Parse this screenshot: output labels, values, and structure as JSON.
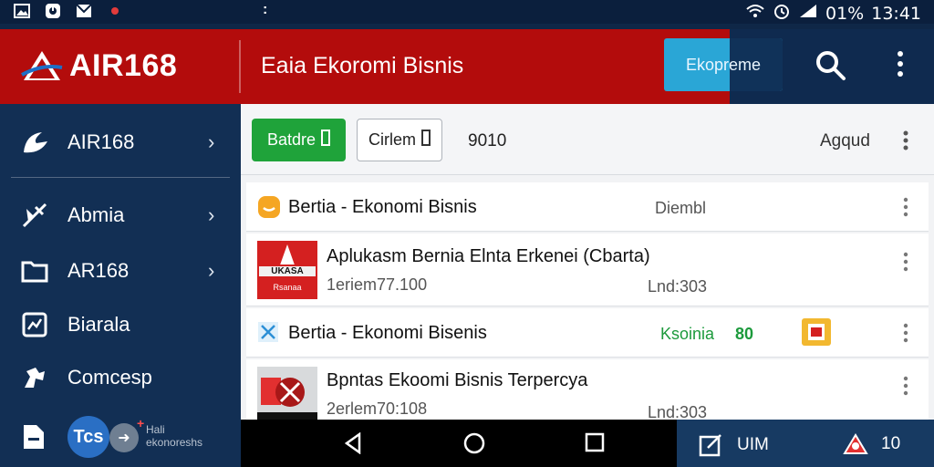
{
  "status_bar": {
    "left_icons": [
      "image-icon",
      "signal-app-icon",
      "mail-icon",
      "notification-dot-icon"
    ],
    "center": ":",
    "battery": "01%",
    "time": "13:41"
  },
  "header": {
    "app_name": "AIR168",
    "title": "Eaia Ekoromi Bisnis",
    "action_button": "Ekopreme",
    "colors": {
      "header_red": "#b30c0c",
      "header_navy": "#0f2a4f",
      "action_blue": "#2aa6d6"
    }
  },
  "sidebar": {
    "items": [
      {
        "label": "AIR168",
        "icon": "airline-logo-icon",
        "chevron": "›"
      },
      {
        "label": "Abmia",
        "icon": "satellite-icon",
        "chevron": "›"
      },
      {
        "label": "AR168",
        "icon": "folder-icon",
        "chevron": "›"
      },
      {
        "label": "Biarala",
        "icon": "chart-icon",
        "chevron": ""
      },
      {
        "label": "Comcesp",
        "icon": "puzzle-icon",
        "chevron": ""
      }
    ],
    "bottom": {
      "avatar_text": "Tcs",
      "plus": "+",
      "caption_line1": "Hali",
      "caption_line2": "ekonoreshs"
    }
  },
  "toolbar": {
    "primary_button": "Batdre",
    "secondary_button": "Cirlem",
    "count": "9010",
    "right_label": "Agqud"
  },
  "list": [
    {
      "title": "Bertia - Ekonomi Bisnis",
      "meta": "Diembl",
      "icon": "coin-icon"
    },
    {
      "title": "Aplukasm Bernia Elnta Erkenei (Cbarta)",
      "subtitle": "1eriem77.100",
      "meta": "Lnd:303",
      "thumb_text": "UKASA",
      "thumb_sub": "Rsanaa",
      "icon": "news-thumbnail-icon"
    },
    {
      "title": "Bertia - Ekonomi Bisenis",
      "meta": "Ksoinia",
      "badge": "80",
      "icon": "cross-icon",
      "side_icon": "calendar-badge-icon"
    },
    {
      "title": "Bpntas Ekoomi Bisnis Terpercya",
      "subtitle": "2erlem70:108",
      "meta": "Lnd:303",
      "icon": "news-thumbnail-icon"
    }
  ],
  "nav": {
    "back": "back-icon",
    "home": "home-icon",
    "recents": "recents-icon"
  },
  "bottom_right": {
    "item1": "UIM",
    "item2": "10"
  }
}
